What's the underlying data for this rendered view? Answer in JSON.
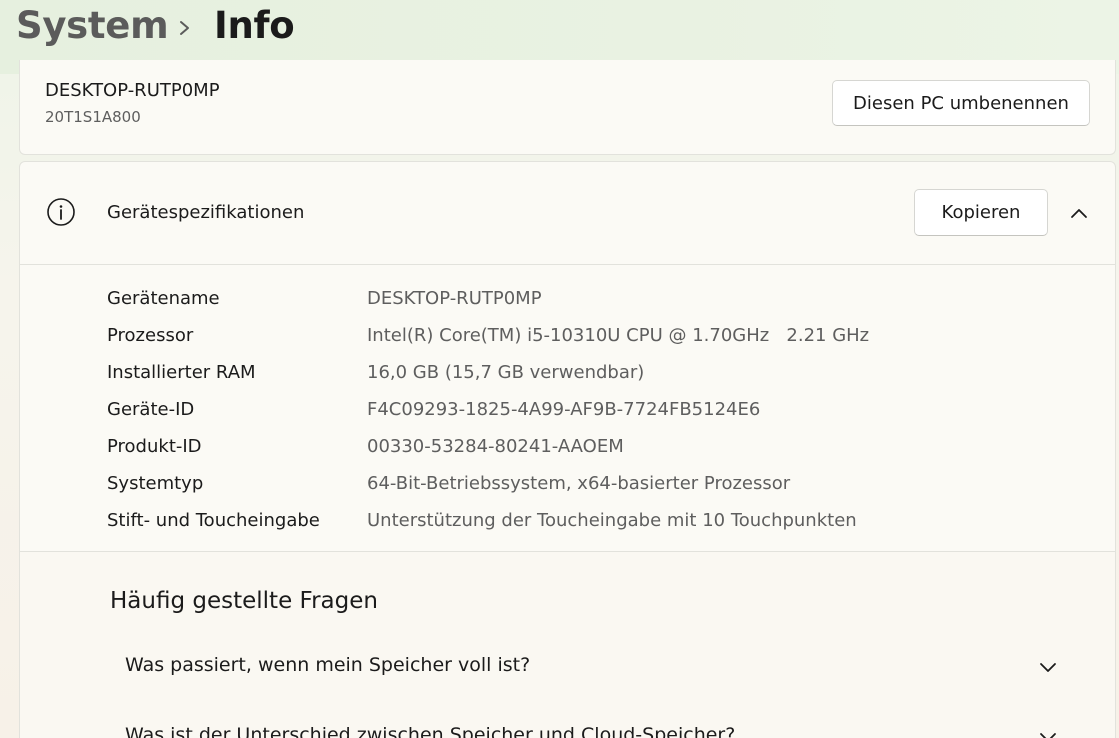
{
  "breadcrumb": {
    "root": "System",
    "current": "Info"
  },
  "pc_card": {
    "name": "DESKTOP-RUTP0MP",
    "model": "20T1S1A800",
    "rename_button": "Diesen PC umbenennen"
  },
  "specs": {
    "title": "Gerätespezifikationen",
    "copy_button": "Kopieren",
    "info_icon": "info-icon",
    "collapse_icon": "chevron-up-icon",
    "rows": [
      {
        "label": "Gerätename",
        "value": "DESKTOP-RUTP0MP"
      },
      {
        "label": "Prozessor",
        "value": "Intel(R) Core(TM) i5-10310U CPU @ 1.70GHz   2.21 GHz"
      },
      {
        "label": "Installierter RAM",
        "value": "16,0 GB (15,7 GB verwendbar)"
      },
      {
        "label": "Geräte-ID",
        "value": "F4C09293-1825-4A99-AF9B-7724FB5124E6"
      },
      {
        "label": "Produkt-ID",
        "value": "00330-53284-80241-AAOEM"
      },
      {
        "label": "Systemtyp",
        "value": "64-Bit-Betriebssystem, x64-basierter Prozessor"
      },
      {
        "label": "Stift- und Toucheingabe",
        "value": "Unterstützung der Toucheingabe mit 10 Touchpunkten"
      }
    ]
  },
  "faq": {
    "title": "Häufig gestellte Fragen",
    "items": [
      {
        "question": "Was passiert, wenn mein Speicher voll ist?"
      },
      {
        "question": "Was ist der Unterschied zwischen Speicher und Cloud-Speicher?"
      }
    ]
  },
  "colors": {
    "text_primary": "#1b1b1b",
    "text_secondary": "#5e5e5e",
    "card_background": "#fbfaf5"
  }
}
